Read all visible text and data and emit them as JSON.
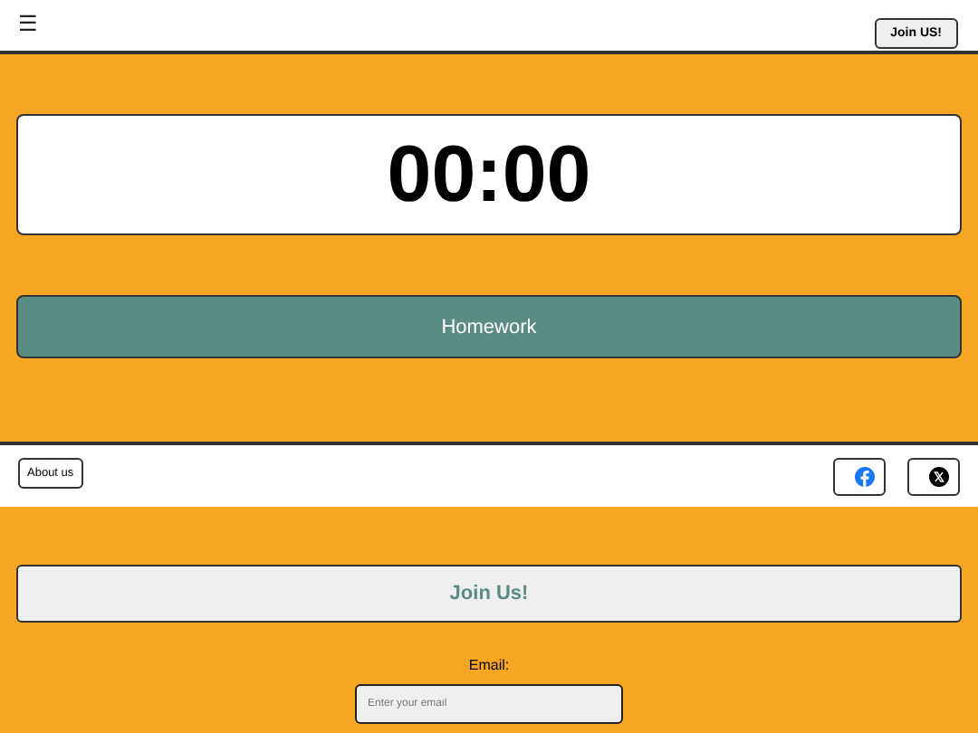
{
  "header": {
    "menu_glyph": "☰",
    "join_button": "Join US!"
  },
  "timer": {
    "display": "00:00"
  },
  "mode_button": {
    "label": "Homework"
  },
  "footer": {
    "about_button": "About us",
    "social": [
      {
        "kind": "facebook"
      },
      {
        "kind": "x"
      }
    ]
  },
  "signup": {
    "title": "Join Us!",
    "email_label": "Email:",
    "email_placeholder": "Enter your email"
  }
}
